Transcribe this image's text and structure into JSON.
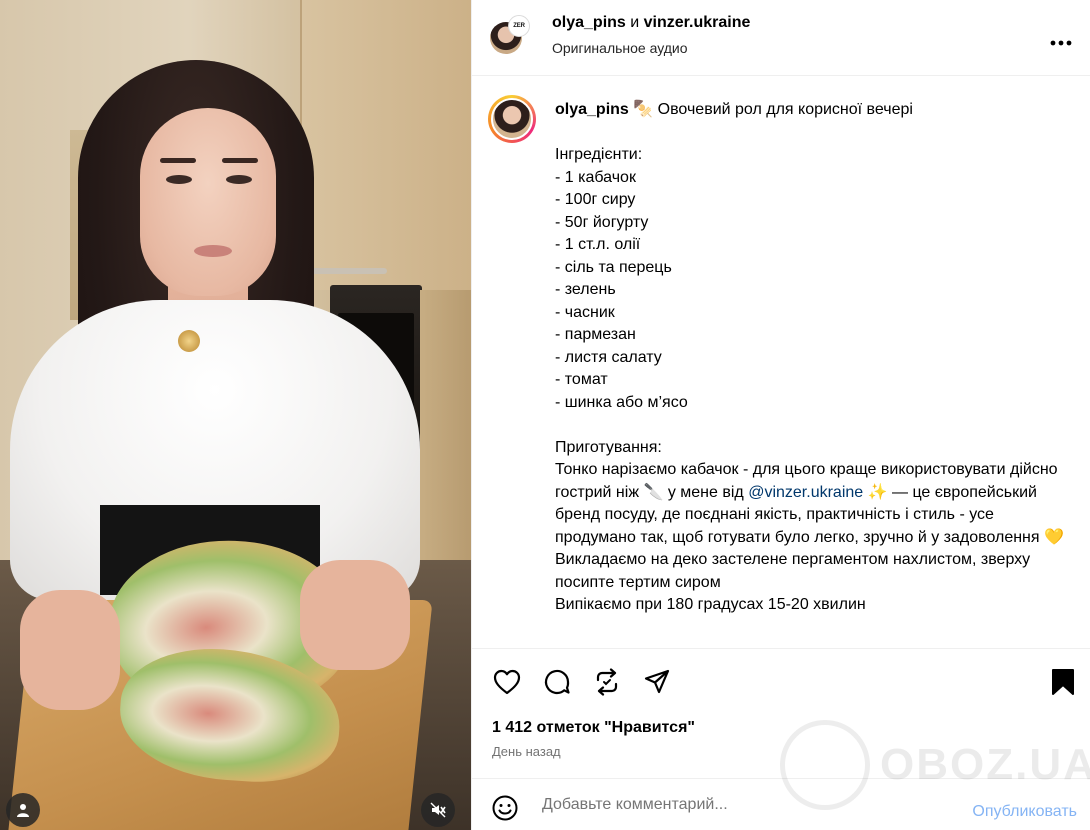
{
  "header": {
    "user1": "olya_pins",
    "conj": "и",
    "user2": "vinzer.ukraine",
    "partner_badge": "ZER",
    "audio": "Оригинальное аудио",
    "more": "•••"
  },
  "caption": {
    "username": "olya_pins",
    "emoji": "🍢",
    "title": "Овочевий рол для корисної вечері",
    "ingredients_heading": "Інгредієнти:",
    "ingredients": [
      "- 1 кабачок",
      "- 100г сиру",
      "- 50г йогурту",
      "- 1 ст.л. олії",
      "- сіль та перець",
      "- зелень",
      "- часник",
      "- пармезан",
      "- листя салату",
      "- томат",
      "- шинка або м’ясо"
    ],
    "prep_heading": "Приготування:",
    "prep_line1_a": "Тонко нарізаємо кабачок - для цього краще використовувати дійсно гострий ніж ",
    "prep_knife": "🔪",
    "prep_line1_b": " у мене від ",
    "mention": "@vinzer.ukraine",
    "prep_sparkle": "✨",
    "prep_line1_c": " — це європейський бренд посуду, де поєднані якість, практичність і стиль - усе продумано так, щоб готувати було легко, зручно й у задоволення ",
    "prep_heart": "💛",
    "prep_line2": "Викладаємо на деко застелене пергаментом нахлистом, зверху посипте тертим сиром",
    "prep_line3": "Випікаємо при 180 градусах 15-20 хвилин"
  },
  "actions": {
    "likes": "1 412 отметок \"Нравится\"",
    "date": "День назад"
  },
  "comment": {
    "placeholder": "Добавьте комментарий...",
    "post": "Опубликовать"
  },
  "watermark": "OBOZ.UA",
  "colors": {
    "link": "#00376b",
    "post_button": "#85b4f4",
    "secondary_text": "#737373",
    "divider": "#efefef"
  }
}
